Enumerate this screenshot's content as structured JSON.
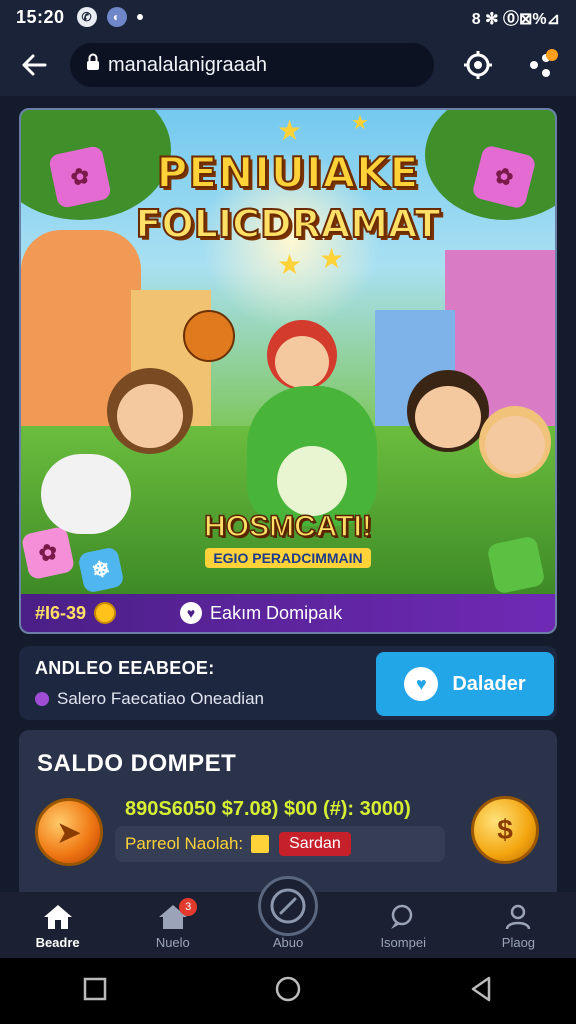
{
  "status_bar": {
    "time": "15:20",
    "icons": [
      "whatsapp-icon",
      "app-icon"
    ],
    "right_text": "8 ✻ ⓪⊠%⊿"
  },
  "browser": {
    "url": "manalalanigraaah",
    "icons": [
      "back-arrow-icon",
      "lock-icon",
      "target-icon",
      "share-icon"
    ]
  },
  "banner": {
    "title_line1": "PENIUIAKE",
    "title_line2": "FOLICDRAMAT",
    "subtitle_big": "HOSMCATI!",
    "subtitle_small": "EGIO PERADCIMMAIN",
    "footer_points": "#I6-39",
    "footer_wallet_label": "Eakım Domipaık"
  },
  "address": {
    "heading": "ANDLEO EEABEOE:",
    "subtext": "Salero Faecatiao Oneadian",
    "button_label": "Dalader"
  },
  "saldo": {
    "heading": "SALDO DOMPET",
    "amount": "890S6050 $7.08) $00 (#): 3000)",
    "pill_label": "Parreol Naolah:",
    "pill_tag": "Sardan"
  },
  "bottom_nav": {
    "items": [
      {
        "label": "Beadre",
        "icon": "home-icon"
      },
      {
        "label": "Nuelo",
        "icon": "house-icon",
        "badge": "3"
      },
      {
        "label": "Abuo",
        "icon": "compass-icon"
      },
      {
        "label": "Isompei",
        "icon": "chat-icon"
      },
      {
        "label": "Plaog",
        "icon": "profile-icon"
      }
    ]
  },
  "colors": {
    "bg": "#141b2c",
    "accent_blue": "#22a6e8",
    "banner_purple": "#6f2ab5",
    "amount_green": "#d6ee34"
  }
}
